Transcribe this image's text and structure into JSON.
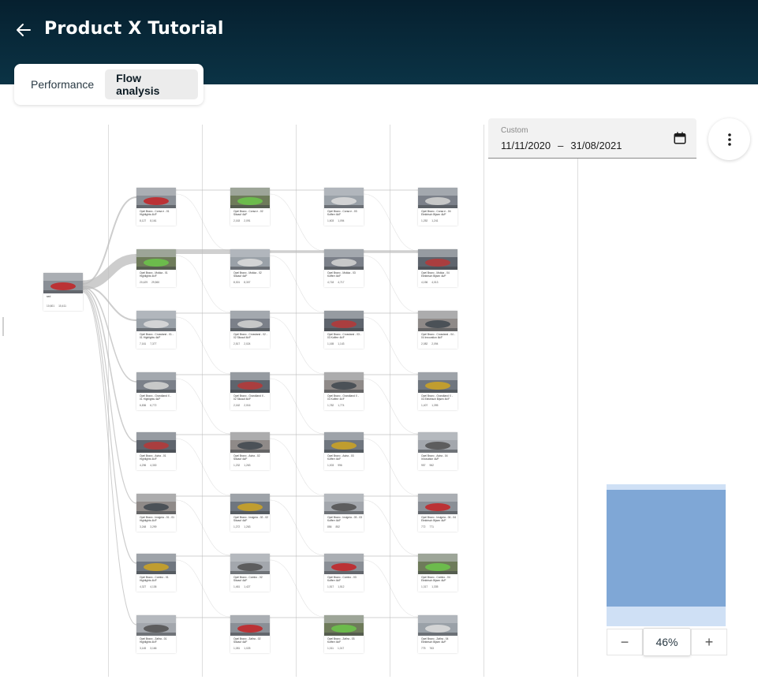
{
  "header": {
    "title": "Product X Tutorial"
  },
  "tabs": [
    {
      "label": "Performance",
      "active": false
    },
    {
      "label": "Flow analysis",
      "active": true
    }
  ],
  "date_filter": {
    "label": "Custom",
    "start": "11/11/2020",
    "separator": "–",
    "end": "31/08/2021"
  },
  "zoom": {
    "level": "46%",
    "minus": "−",
    "plus": "+"
  },
  "root": {
    "title": "sed",
    "views": "10,601",
    "plays": "10,411"
  },
  "columns": [
    {
      "cards": [
        {
          "title": "Opel Bravo - Corsa e - 01 Highlights 4k/F",
          "views": "8,127",
          "plays": "8,161"
        },
        {
          "title": "Opel Bravo - Mokka - 01 Highlights 4k/F",
          "views": "20,429",
          "plays": "29,560"
        },
        {
          "title": "Opel Bravo - Crossland - 01 - 01 Highlights 4k/F",
          "views": "7,161",
          "plays": "7,377"
        },
        {
          "title": "Opel Bravo - Grandland X - 01 Highlights 4k/F",
          "views": "6,836",
          "plays": "6,772"
        },
        {
          "title": "Opel Bravo - Astra - 01 Highlights 4k/F",
          "views": "4,296",
          "plays": "4,330"
        },
        {
          "title": "Opel Bravo - Insignia - 01 - 01 Highlights 4k/F",
          "views": "3,248",
          "plays": "3,299"
        },
        {
          "title": "Opel Bravo - Combo - 01 Highlights 4k/F",
          "views": "4,327",
          "plays": "4,136"
        },
        {
          "title": "Opel Bravo - Zafira - 01 Highlights 4k/F",
          "views": "3,145",
          "plays": "3,166"
        }
      ]
    },
    {
      "cards": [
        {
          "title": "Opel Bravo - Corsa e - 02 Sitzauf 4k/F",
          "views": "2,163",
          "plays": "2,091"
        },
        {
          "title": "Opel Bravo - Mokka - 02 Sitzauf 4k/F",
          "views": "8,301",
          "plays": "8,307"
        },
        {
          "title": "Opel Bravo - Crossland - 02 - 02 Sitzauf 4k/F",
          "views": "2,517",
          "plays": "2,024"
        },
        {
          "title": "Opel Bravo - Grandland X - 02 Sitzauf 4k/F",
          "views": "2,162",
          "plays": "2,016"
        },
        {
          "title": "Opel Bravo - Astra - 02 Sitzauf 4k/F",
          "views": "1,232",
          "plays": "1,263"
        },
        {
          "title": "Opel Bravo - Insignia - 02 - 02 Sitzauf 4k/F",
          "views": "1,272",
          "plays": "1,263"
        },
        {
          "title": "Opel Bravo - Combo - 02 Sitzauf 4k/F",
          "views": "1,461",
          "plays": "1,427"
        },
        {
          "title": "Opel Bravo - Zafira - 02 Sitzauf 4k/F",
          "views": "1,081",
          "plays": "1,025"
        }
      ]
    },
    {
      "cards": [
        {
          "title": "Opel Bravo - Corsa e - 03 Kofferr 4k/F",
          "views": "1,603",
          "plays": "1,094"
        },
        {
          "title": "Opel Bravo - Mokka - 03 Kofferr 4k/F",
          "views": "4,718",
          "plays": "4,717"
        },
        {
          "title": "Opel Bravo - Crossland - 03 - 03 Kofferr 4k/F",
          "views": "1,165",
          "plays": "1,143"
        },
        {
          "title": "Opel Bravo - Grandland X - 03 Kofferr 4k/F",
          "views": "1,782",
          "plays": "1,774"
        },
        {
          "title": "Opel Bravo - Astra - 03 Kofferr 4k/F",
          "views": "1,003",
          "plays": "996"
        },
        {
          "title": "Opel Bravo - Insignia - 03 - 03 Kofferr 4k/F",
          "views": "856",
          "plays": "852"
        },
        {
          "title": "Opel Bravo - Combo - 03 Kofferr 4k/F",
          "views": "1,517",
          "plays": "1,512"
        },
        {
          "title": "Opel Bravo - Zafira - 03 Kofferr 4k/F",
          "views": "1,011",
          "plays": "1,017"
        }
      ]
    },
    {
      "cards": [
        {
          "title": "Opel Bravo - Corsa e - 04 Elektrisch Bijsen 4k/F",
          "views": "1,252",
          "plays": "1,241"
        },
        {
          "title": "Opel Bravo - Mokka - 04 Elektrisch Bijsen 4k/F",
          "views": "4,156",
          "plays": "4,013"
        },
        {
          "title": "Opel Bravo - Crossland - 04 - 04 Innovation 4k/F",
          "views": "2,082",
          "plays": "2,094"
        },
        {
          "title": "Opel Bravo - Grandland X - 04 Elektrisch Bijsen 4k/F",
          "views": "1,407",
          "plays": "1,395"
        },
        {
          "title": "Opel Bravo - Astra - 04 Innovation 4k/F",
          "views": "957",
          "plays": "962"
        },
        {
          "title": "Opel Bravo - Insignia - 04 - 04 Elektrisch Bijsen 4k/F",
          "views": "772",
          "plays": "771"
        },
        {
          "title": "Opel Bravo - Combo - 04 Elektrisch Bijsen 4k/F",
          "views": "1,317",
          "plays": "1,335"
        },
        {
          "title": "Opel Bravo - Zafira - 04 Elektrisch Bijsen 4k/F",
          "views": "775",
          "plays": "763"
        }
      ]
    }
  ],
  "colors": {
    "header_bg": "#06202f",
    "minimap": "#cfe0f5",
    "minimap_viewport": "#7fa7d6",
    "flow_link": "#bcbcbc"
  }
}
